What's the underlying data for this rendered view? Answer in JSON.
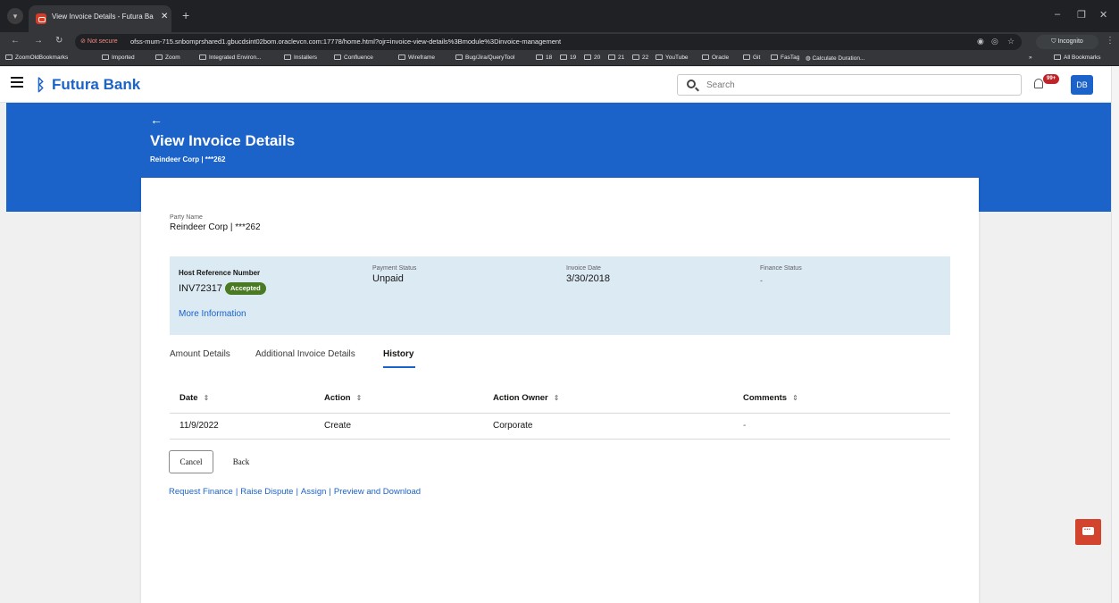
{
  "browser": {
    "tab_title": "View Invoice Details - Futura Ba",
    "url_security": "Not secure",
    "url": "ofss-mum-715.snbomprshared1.gbucdsint02bom.oraclevcn.com:17778/home.html?ojr=invoice-view-details%3Bmodule%3Dinvoice-management",
    "incognito_label": "Incognito",
    "bookmarks": [
      "ZoomOldBookmarks",
      "Imported",
      "Zoom",
      "Integrated Environ...",
      "Installers",
      "Confluence",
      "Wireframe",
      "Bug/Jira/QueryTool",
      "18",
      "19",
      "20",
      "21",
      "22",
      "YouTube",
      "Oracle",
      "Git",
      "FasTag",
      "Calculate Duration..."
    ],
    "all_bookmarks": "All Bookmarks"
  },
  "header": {
    "brand": "Futura Bank",
    "search_placeholder": "Search",
    "notification_count": "99+",
    "avatar_initials": "DB"
  },
  "page": {
    "title": "View Invoice Details",
    "subtitle": "Reindeer Corp | ***262"
  },
  "party": {
    "label": "Party Name",
    "value": "Reindeer Corp | ***262"
  },
  "invoice": {
    "host_ref_label": "Host Reference Number",
    "host_ref_value": "INV72317",
    "status_badge": "Accepted",
    "payment_status_label": "Payment Status",
    "payment_status_value": "Unpaid",
    "invoice_date_label": "Invoice Date",
    "invoice_date_value": "3/30/2018",
    "finance_status_label": "Finance Status",
    "finance_status_value": "-",
    "more_info": "More Information"
  },
  "tabs": [
    "Amount Details",
    "Additional Invoice Details",
    "History"
  ],
  "history": {
    "columns": [
      "Date",
      "Action",
      "Action Owner",
      "Comments"
    ],
    "rows": [
      [
        "11/9/2022",
        "Create",
        "Corporate",
        "-"
      ]
    ]
  },
  "buttons": {
    "cancel": "Cancel",
    "back": "Back"
  },
  "links": [
    "Request Finance",
    "Raise Dispute",
    "Assign",
    "Preview and Download"
  ],
  "colors": {
    "brand_blue": "#1b62c9",
    "accepted_green": "#4a7a23",
    "info_panel": "#dceaf4",
    "chat_red": "#d3442f"
  }
}
